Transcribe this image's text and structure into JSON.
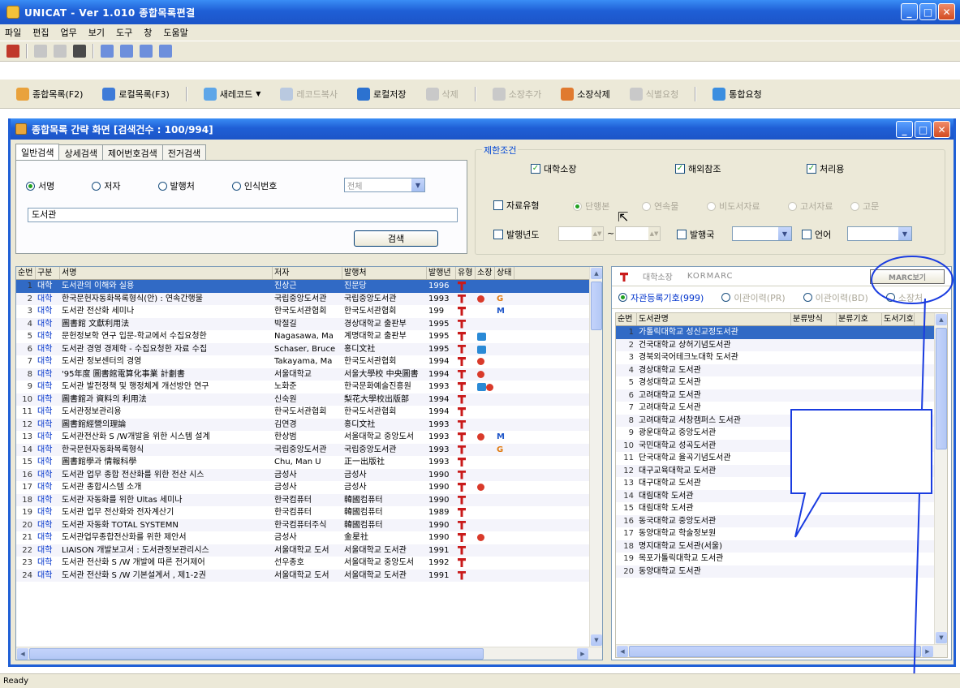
{
  "window": {
    "title": "UNICAT - Ver 1.010  종합목록편결"
  },
  "menu": [
    "파일",
    "편집",
    "업무",
    "보기",
    "도구",
    "창",
    "도움말"
  ],
  "toolbar": [
    {
      "label": "종합목록(F2)",
      "color": "#e9a23c",
      "disabled": false
    },
    {
      "label": "로컬목록(F3)",
      "color": "#3e7bd8",
      "disabled": false
    },
    {
      "label": "새레코드",
      "color": "#5ea6e8",
      "disabled": false,
      "dropdown": true
    },
    {
      "label": "레코드복사",
      "color": "#b9c9e0",
      "disabled": true
    },
    {
      "label": "로컬저장",
      "color": "#2c72d0",
      "disabled": false
    },
    {
      "label": "삭제",
      "color": "#c9c9c9",
      "disabled": true
    },
    {
      "label": "소장추가",
      "color": "#c9c9c9",
      "disabled": true
    },
    {
      "label": "소장삭제",
      "color": "#e07a2f",
      "disabled": false
    },
    {
      "label": "식별요청",
      "color": "#c9c9c9",
      "disabled": true
    },
    {
      "label": "통합요청",
      "color": "#3b8ee0",
      "disabled": false
    }
  ],
  "child": {
    "title": "종합목록 간략 화면  [검색건수 : 100/994]"
  },
  "search": {
    "tabs": [
      "일반검색",
      "상세검색",
      "제어번호검색",
      "전거검색"
    ],
    "radios": [
      "서명",
      "저자",
      "발행처",
      "인식번호"
    ],
    "id_select": "전체",
    "query": "도서관",
    "button": "검색"
  },
  "filters": {
    "legend": "제한조건",
    "checks": [
      "대학소장",
      "해외참조",
      "처리용"
    ],
    "type_label": "자료유형",
    "type_options": [
      "단행본",
      "연속물",
      "비도서자료",
      "고서자료",
      "고문"
    ],
    "year_label": "발행년도",
    "year_sep": "~",
    "country_label": "발행국",
    "lang_label": "언어"
  },
  "grid": {
    "columns": [
      "순번",
      "구분",
      "서명",
      "저자",
      "발행처",
      "발행년",
      "유형",
      "소장",
      "상태"
    ],
    "rows": [
      {
        "n": "1",
        "k": "대학",
        "t": "도서관의 이해와 실용",
        "a": "진상근",
        "p": "진문당",
        "y": "1996",
        "s": "",
        "st": ""
      },
      {
        "n": "2",
        "k": "대학",
        "t": "한국문헌자동화목록형식(안) : 연속간행물",
        "a": "국립중앙도서관",
        "p": "국립중앙도서관",
        "y": "1993",
        "s": "o",
        "st": "G"
      },
      {
        "n": "3",
        "k": "대학",
        "t": "도서관 전산화 세미나",
        "a": "한국도서관협회",
        "p": "한국도서관협회",
        "y": "199",
        "s": "",
        "st": "M"
      },
      {
        "n": "4",
        "k": "대학",
        "t": "圖書館 文獻利用法",
        "a": "박절길",
        "p": "경상대학교 출판부",
        "y": "1995",
        "s": "",
        "st": ""
      },
      {
        "n": "5",
        "k": "대학",
        "t": "문헌정보학 연구 입문-학교에서 수집요청한",
        "a": "Nagasawa, Ma",
        "p": "계명대학교 출판부",
        "y": "1995",
        "s": "b",
        "st": ""
      },
      {
        "n": "6",
        "k": "대학",
        "t": "도서관 경영 경제학 - 수집요청한 자료 수집",
        "a": "Schaser, Bruce",
        "p": "홍디文社",
        "y": "1995",
        "s": "b",
        "st": ""
      },
      {
        "n": "7",
        "k": "대학",
        "t": "도서관 정보센터의 경영",
        "a": "Takayama, Ma",
        "p": "한국도서관협회",
        "y": "1994",
        "s": "o",
        "st": ""
      },
      {
        "n": "8",
        "k": "대학",
        "t": "'95年度 圖書館電算化事業 計劃書",
        "a": "서울대학교",
        "p": "서울大學校 中央圖書",
        "y": "1994",
        "s": "o",
        "st": ""
      },
      {
        "n": "9",
        "k": "대학",
        "t": "도서관 발전정책 및 행정체계 개선방안 연구",
        "a": "노화준",
        "p": "한국문화예술진흥원",
        "y": "1993",
        "s": "bo",
        "st": ""
      },
      {
        "n": "10",
        "k": "대학",
        "t": "圖書館과 資料의 利用法",
        "a": "신숙원",
        "p": "梨花大學校出版部",
        "y": "1994",
        "s": "",
        "st": ""
      },
      {
        "n": "11",
        "k": "대학",
        "t": "도서관정보관리용",
        "a": "한국도서관협회",
        "p": "한국도서관협회",
        "y": "1994",
        "s": "",
        "st": ""
      },
      {
        "n": "12",
        "k": "대학",
        "t": "圖書館經營의理論",
        "a": "김연경",
        "p": "홍디文社",
        "y": "1993",
        "s": "",
        "st": ""
      },
      {
        "n": "13",
        "k": "대학",
        "t": "도서관전산화 S /W개발을 위한 시스템 설계",
        "a": "한상범",
        "p": "서울대학교 중앙도서",
        "y": "1993",
        "s": "o",
        "st": "M"
      },
      {
        "n": "14",
        "k": "대학",
        "t": "한국문헌자동화목록형식",
        "a": "국립중앙도서관",
        "p": "국립중앙도서관",
        "y": "1993",
        "s": "",
        "st": "G"
      },
      {
        "n": "15",
        "k": "대학",
        "t": "圖書館學과 情報科學",
        "a": "Chu, Man U",
        "p": "正一出版社",
        "y": "1993",
        "s": "",
        "st": ""
      },
      {
        "n": "16",
        "k": "대학",
        "t": "도서관 업무 종합 전산화를 위한 전산 시스",
        "a": "금성사",
        "p": "금성사",
        "y": "1990",
        "s": "",
        "st": ""
      },
      {
        "n": "17",
        "k": "대학",
        "t": "도서관 종합시스템 소개",
        "a": "금성사",
        "p": "금성사",
        "y": "1990",
        "s": "o",
        "st": ""
      },
      {
        "n": "18",
        "k": "대학",
        "t": "도서관 자동화를 위한 Ultas 세미나",
        "a": "한국컴퓨터",
        "p": "韓國컴퓨터",
        "y": "1990",
        "s": "",
        "st": ""
      },
      {
        "n": "19",
        "k": "대학",
        "t": "도서관 업무 전산화와 전자계산기",
        "a": "한국컴퓨터",
        "p": "韓國컴퓨터",
        "y": "1989",
        "s": "",
        "st": ""
      },
      {
        "n": "20",
        "k": "대학",
        "t": "도서관 자동화 TOTAL SYSTEMN",
        "a": "한국컴퓨터주식",
        "p": "韓國컴퓨터",
        "y": "1990",
        "s": "",
        "st": ""
      },
      {
        "n": "21",
        "k": "대학",
        "t": "도서관업무종합전산화를 위한 제안서",
        "a": "금성사",
        "p": "金星社",
        "y": "1990",
        "s": "o",
        "st": ""
      },
      {
        "n": "22",
        "k": "대학",
        "t": "LIAISON 개발보고서 : 도서관정보관리시스",
        "a": "서울대학교 도서",
        "p": "서울대학교 도서관",
        "y": "1991",
        "s": "",
        "st": ""
      },
      {
        "n": "23",
        "k": "대학",
        "t": "도서관 전산화 S /W 개발에 따른 전거제어",
        "a": "선우종호",
        "p": "서울대학교 중앙도서",
        "y": "1992",
        "s": "",
        "st": ""
      },
      {
        "n": "24",
        "k": "대학",
        "t": "도서관 전산화 S /W 기본설계서 , 제1-2권",
        "a": "서울대학교 도서",
        "p": "서울대학교 도서관",
        "y": "1991",
        "s": "",
        "st": ""
      }
    ]
  },
  "right": {
    "tabs": [
      "대학소장",
      "KORMARC"
    ],
    "marc_button": "MARC보기",
    "radios": [
      "자관등록기호(999)",
      "이관이력(PR)",
      "이관이력(BD)",
      "소장처"
    ],
    "columns": [
      "순번",
      "도서관명",
      "분류방식",
      "분류기호",
      "도서기호"
    ],
    "rows": [
      {
        "n": "1",
        "name": "가톨릭대학교 성신교정도서관"
      },
      {
        "n": "2",
        "name": "건국대학교 상허기념도서관"
      },
      {
        "n": "3",
        "name": "경북외국어테크노대학 도서관"
      },
      {
        "n": "4",
        "name": "경상대학교 도서관"
      },
      {
        "n": "5",
        "name": "경성대학교 도서관"
      },
      {
        "n": "6",
        "name": "고려대학교 도서관"
      },
      {
        "n": "7",
        "name": "고려대학교 도서관"
      },
      {
        "n": "8",
        "name": "고려대학교 서창캠퍼스 도서관"
      },
      {
        "n": "9",
        "name": "광운대학교 중앙도서관"
      },
      {
        "n": "10",
        "name": "국민대학교 성곡도서관"
      },
      {
        "n": "11",
        "name": "단국대학교 율곡기념도서관"
      },
      {
        "n": "12",
        "name": "대구교육대학교 도서관"
      },
      {
        "n": "13",
        "name": "대구대학교 도서관"
      },
      {
        "n": "14",
        "name": "대림대학 도서관"
      },
      {
        "n": "15",
        "name": "대림대학 도서관"
      },
      {
        "n": "16",
        "name": "동국대학교 중앙도서관"
      },
      {
        "n": "17",
        "name": "동양대학교 학술정보원"
      },
      {
        "n": "18",
        "name": "명지대학교 도서관(서울)"
      },
      {
        "n": "19",
        "name": "목포가톨릭대학교 도서관"
      },
      {
        "n": "20",
        "name": "동양대학교 도서관"
      }
    ]
  },
  "status": "Ready"
}
